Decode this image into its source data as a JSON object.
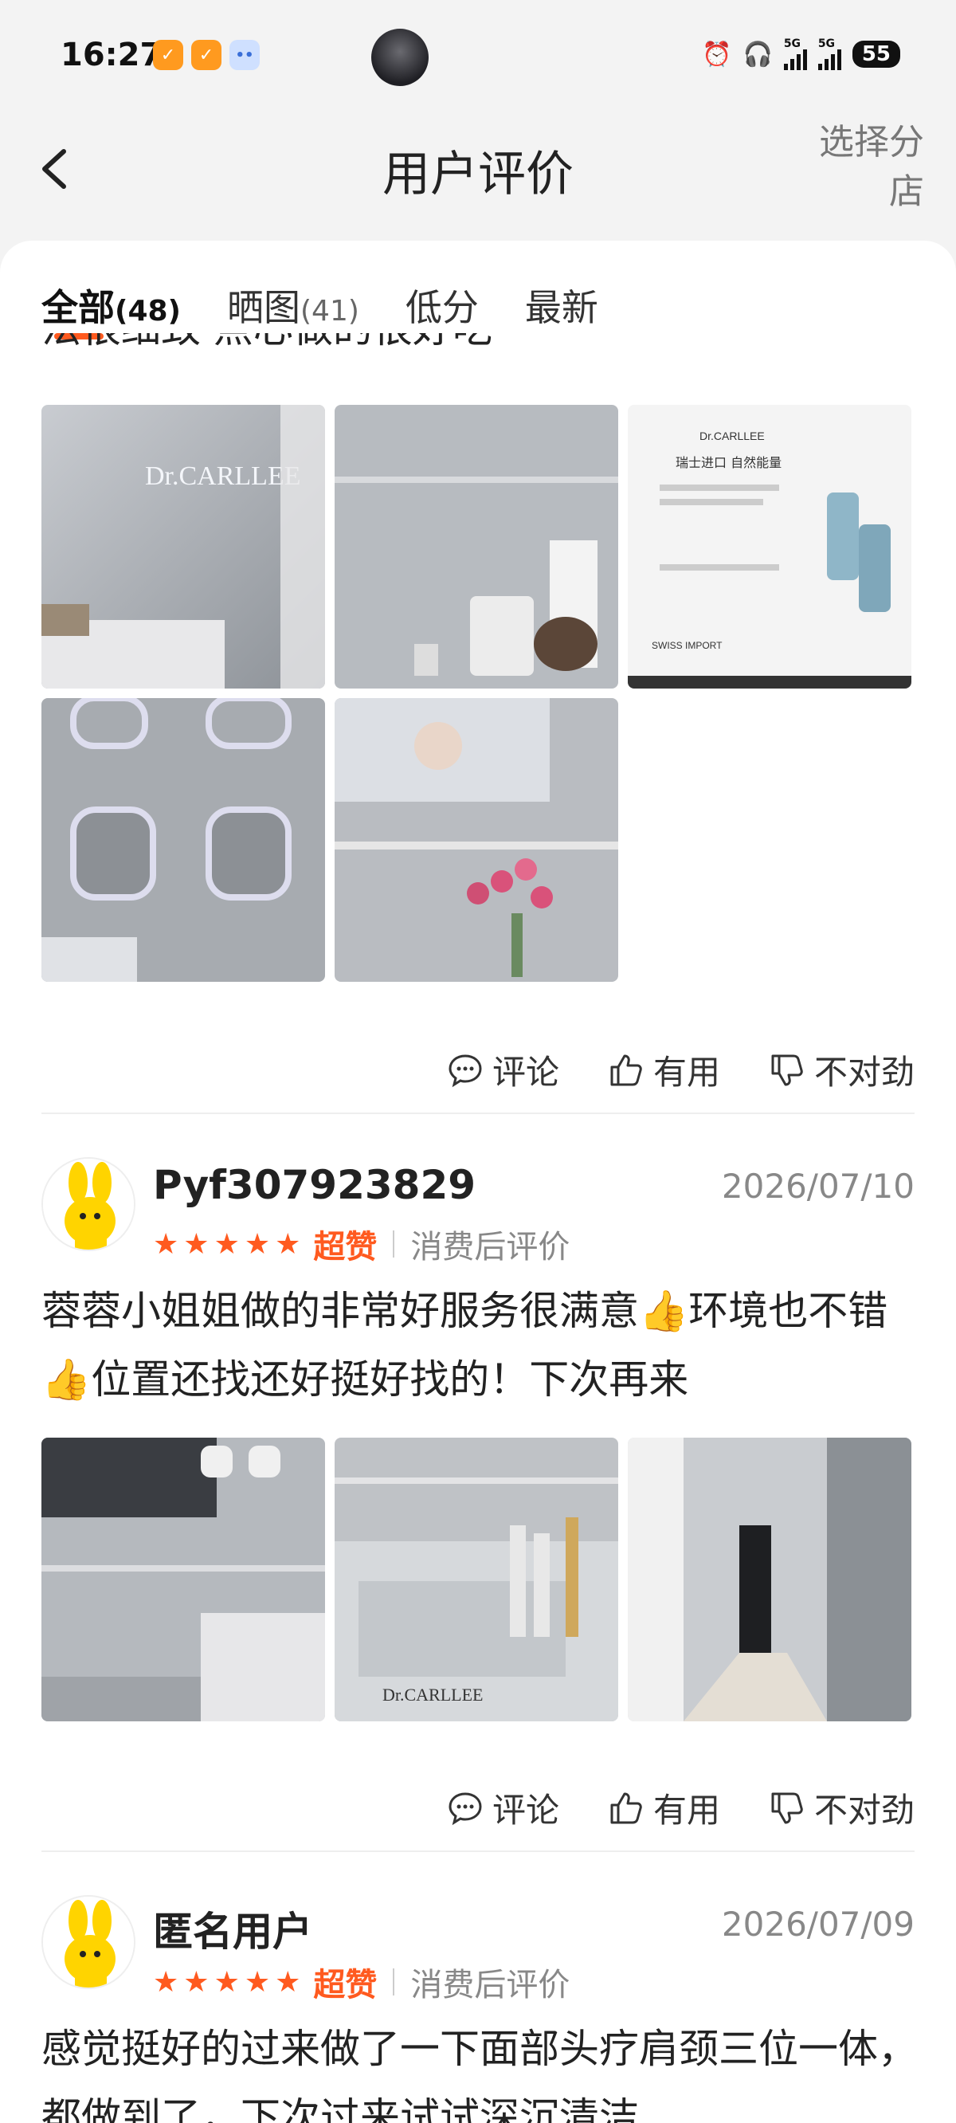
{
  "status_bar": {
    "time": "16:27",
    "signal_1": "5G",
    "signal_2": "5G",
    "battery": "55"
  },
  "nav": {
    "title": "用户评价",
    "select_shop": "选择分店"
  },
  "tabs": [
    {
      "label": "全部",
      "count": "(48)"
    },
    {
      "label": "晒图",
      "count": "(41)"
    },
    {
      "label": "低分",
      "count": ""
    },
    {
      "label": "最新",
      "count": ""
    }
  ],
  "top_review": {
    "cut_text": "法很细致 点心做的很好吃"
  },
  "actions": {
    "comment": "评论",
    "useful": "有用",
    "wrong": "不对劲"
  },
  "reviews": [
    {
      "user": "Pyf307923829",
      "date": "2026/07/10",
      "praise": "超赞",
      "type": "消费后评价",
      "text": "蓉蓉小姐姐做的非常好服务很满意👍环境也不错👍位置还找还好挺好找的！下次再来"
    },
    {
      "user": "匿名用户",
      "date": "2026/07/09",
      "praise": "超赞",
      "type": "消费后评价",
      "text": "感觉挺好的过来做了一下面部头疗肩颈三位一体，都做到了，下次过来试试深沉清洁"
    }
  ],
  "photo_text": {
    "brand": "Dr.CARLLEE",
    "swiss_title": "瑞士进口 自然能量",
    "swiss_import": "SWISS IMPORT"
  }
}
